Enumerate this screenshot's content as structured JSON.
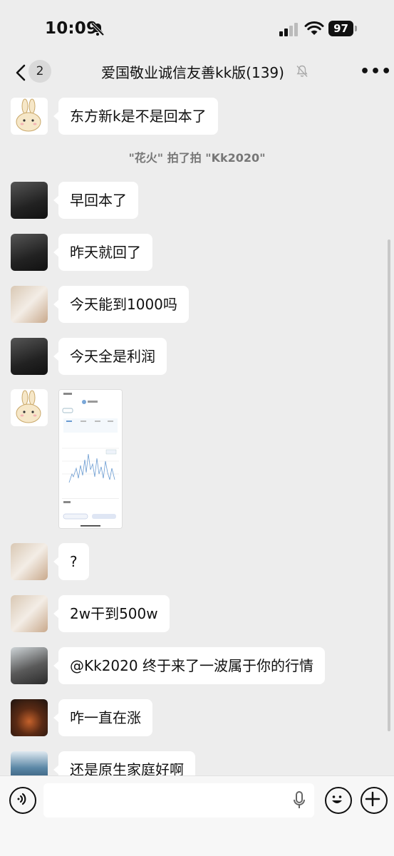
{
  "status_bar": {
    "time": "10:09",
    "battery": "97"
  },
  "nav": {
    "unread_count": "2",
    "title": "爱国敬业诚信友善kk版(139)"
  },
  "messages": [
    {
      "text": "东方新k是不是回本了"
    },
    {
      "text": "早回本了"
    },
    {
      "text": "昨天就回了"
    },
    {
      "text": "今天能到1000吗"
    },
    {
      "text": "今天全是利润"
    },
    {
      "text": "?"
    },
    {
      "text": "2w干到500w"
    },
    {
      "text": "@Kk2020 终于来了一波属于你的行情"
    },
    {
      "text": "咋一直在涨"
    },
    {
      "text": "还是原生家庭好啊"
    }
  ],
  "system_notice": "\"花火\" 拍了拍 \"Kk2020\"",
  "icons": {
    "back": "chevron-left-icon",
    "mute": "bell-off-icon",
    "more": "more-icon",
    "voice": "voice-icon",
    "mic": "mic-icon",
    "emoji": "emoji-icon",
    "plus": "plus-icon"
  },
  "colors": {
    "background": "#ededed",
    "bubble": "#ffffff",
    "system_text": "#777777"
  }
}
